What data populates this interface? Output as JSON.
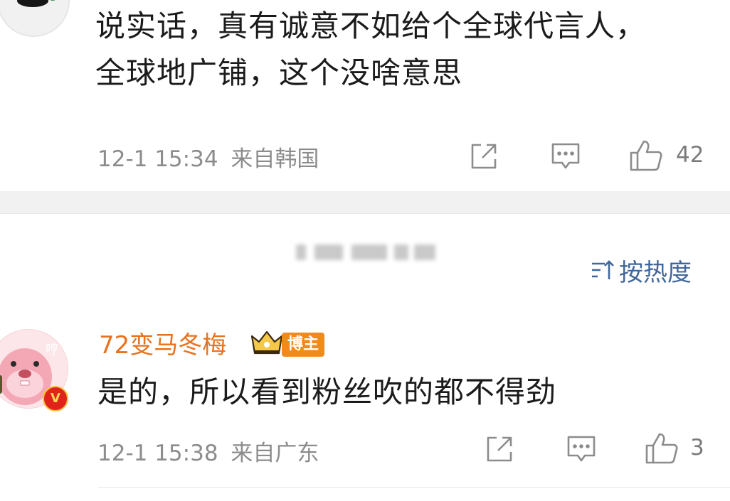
{
  "comments": [
    {
      "text": "说实话，真有诚意不如给个全球代言人，全球地广铺，这个没啥意思",
      "time": "12-1 15:34",
      "location": "来自韩国",
      "likes": "42"
    },
    {
      "username": "72变马冬梅",
      "badge_label": "博主",
      "avatar_caption": "哼",
      "verified_mark": "V",
      "text": "是的，所以看到粉丝吹的都不得劲",
      "time": "12-1 15:38",
      "location": "来自广东",
      "likes": "3"
    }
  ],
  "sort": {
    "label": "按热度"
  },
  "colors": {
    "username": "#e8721d",
    "sort_accent": "#43679a",
    "meta_gray": "#8c8c8c",
    "badge_orange": "#f08a1c",
    "separator": "#f1f1f1"
  },
  "icons": [
    "share-icon",
    "comment-icon",
    "like-icon",
    "sort-icon",
    "crown-icon",
    "verified-badge-icon"
  ]
}
